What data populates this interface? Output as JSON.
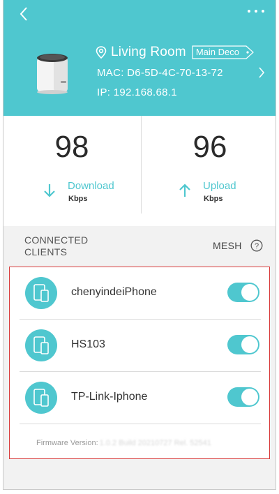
{
  "header": {
    "room_name": "Living Room",
    "role_tag": "Main Deco",
    "mac": "MAC: D6-5D-4C-70-13-72",
    "ip": "IP: 192.168.68.1",
    "accent_color": "#4fc7cf"
  },
  "speeds": {
    "download": {
      "value": "98",
      "label": "Download",
      "unit": "Kbps"
    },
    "upload": {
      "value": "96",
      "label": "Upload",
      "unit": "Kbps"
    }
  },
  "clients": {
    "title": "CONNECTED CLIENTS",
    "mesh_label": "MESH",
    "items": [
      {
        "name": "chenyindeiPhone",
        "enabled": true
      },
      {
        "name": "HS103",
        "enabled": true
      },
      {
        "name": "TP-Link-Iphone",
        "enabled": true
      }
    ]
  },
  "firmware": {
    "label": "Firmware Version:",
    "value": "1.0.2 Build 20210727 Rel. 52541"
  }
}
